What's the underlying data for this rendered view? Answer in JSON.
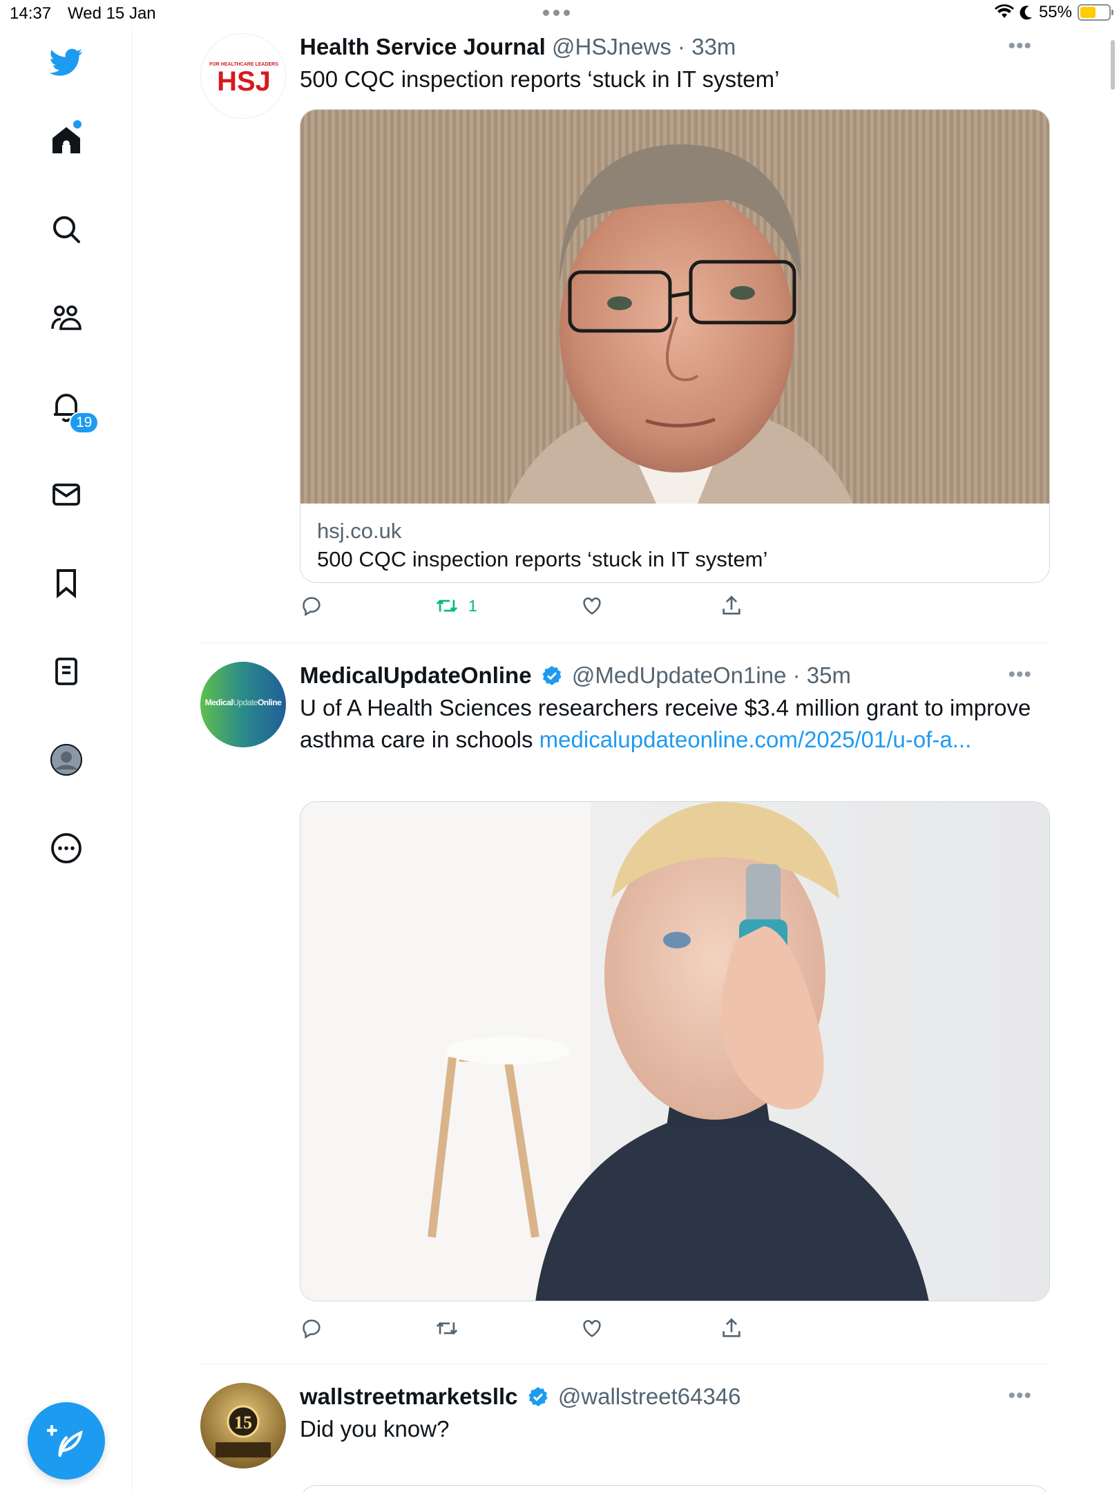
{
  "status_bar": {
    "time": "14:37",
    "date": "Wed 15 Jan",
    "battery": "55%"
  },
  "sidebar": {
    "items": [
      {
        "icon": "home-icon",
        "label": "Home"
      },
      {
        "icon": "search-icon",
        "label": "Explore"
      },
      {
        "icon": "communities-icon",
        "label": "Communities"
      },
      {
        "icon": "bell-icon",
        "label": "Notifications"
      },
      {
        "icon": "mail-icon",
        "label": "Messages"
      },
      {
        "icon": "bookmark-icon",
        "label": "Bookmarks"
      },
      {
        "icon": "lists-icon",
        "label": "Lists"
      },
      {
        "icon": "profile-icon",
        "label": "Profile"
      },
      {
        "icon": "more-circle-icon",
        "label": "More"
      }
    ],
    "notification_count": "19"
  },
  "tweets": [
    {
      "name": "Health Service Journal",
      "handle": "@HSJnews",
      "time": "33m",
      "text": "500 CQC inspection reports ‘stuck in IT system’",
      "avatar_label": "HSJ",
      "avatar_tagline": "FOR HEALTHCARE LEADERS",
      "card_domain": "hsj.co.uk",
      "card_title": "500 CQC inspection reports ‘stuck in IT system’",
      "retweets": "1",
      "colors": {
        "brand": "#d71920",
        "retweet_active": "#00ba7c"
      }
    },
    {
      "name": "MedicalUpdateOnline",
      "handle": "@MedUpdateOn1ine",
      "time": "35m",
      "text": "U of A Health Sciences researchers receive $3.4 million grant to improve asthma care in schools ",
      "link": "medicalupdateonline.com/2025/01/u-of-a...",
      "avatar_label_a": "Medical",
      "avatar_label_b": "Update",
      "avatar_label_c": "Online"
    },
    {
      "name": "wallstreetmarketsllc",
      "handle": "@wallstreet64346",
      "text": "Did you know?",
      "avatar_label": "15"
    }
  ],
  "colors": {
    "accent": "#1d9bf0",
    "text": "#0f1419",
    "muted": "#536471"
  }
}
